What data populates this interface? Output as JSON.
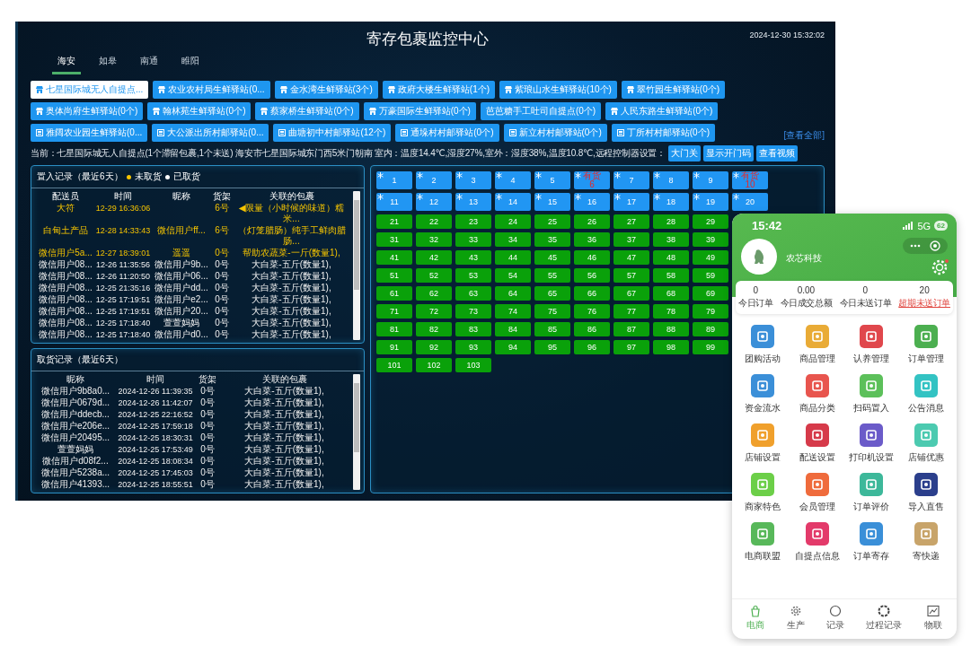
{
  "dashboard": {
    "title": "寄存包裹监控中心",
    "datetime": "2024-12-30 15:32:02",
    "tabs": [
      {
        "label": "海安",
        "selected": true
      },
      {
        "label": "如皋",
        "selected": false
      },
      {
        "label": "南通",
        "selected": false
      },
      {
        "label": "睢阳",
        "selected": false
      }
    ],
    "stations": [
      {
        "label": "七星国际城无人自提点...",
        "kind": "fresh",
        "selected": true
      },
      {
        "label": "农业农村局生鲜驿站(0...",
        "kind": "fresh",
        "selected": false
      },
      {
        "label": "金水湾生鲜驿站(3个)",
        "kind": "fresh",
        "selected": false
      },
      {
        "label": "政府大楼生鲜驿站(1个)",
        "kind": "fresh",
        "selected": false
      },
      {
        "label": "紫琅山水生鲜驿站(10个)",
        "kind": "fresh",
        "selected": false
      },
      {
        "label": "翠竹园生鲜驿站(0个)",
        "kind": "fresh",
        "selected": false
      },
      {
        "label": "奥体尚府生鲜驿站(0个)",
        "kind": "fresh",
        "selected": false
      },
      {
        "label": "翰林苑生鲜驿站(0个)",
        "kind": "fresh",
        "selected": false
      },
      {
        "label": "蔡家桥生鲜驿站(0个)",
        "kind": "fresh",
        "selected": false
      },
      {
        "label": "万豪国际生鲜驿站(0个)",
        "kind": "fresh",
        "selected": false
      },
      {
        "label": "芭芭糖手工吐司自提点(0个)",
        "kind": "pickup",
        "selected": false
      },
      {
        "label": "人民东路生鲜驿站(0个)",
        "kind": "fresh",
        "selected": false
      },
      {
        "label": "雅阔农业园生鲜驿站(0...",
        "kind": "village",
        "selected": false
      },
      {
        "label": "大公派出所村邮驿站(0...",
        "kind": "village",
        "selected": false
      },
      {
        "label": "曲塘初中村邮驿站(12个)",
        "kind": "village",
        "selected": false
      },
      {
        "label": "通垛村村邮驿站(0个)",
        "kind": "village",
        "selected": false
      },
      {
        "label": "新立村村邮驿站(0个)",
        "kind": "village",
        "selected": false
      },
      {
        "label": "丁所村村邮驿站(0个)",
        "kind": "village",
        "selected": false
      }
    ],
    "view_all_link": "[查看全部]",
    "info": {
      "text": "当前：七星国际城无人自提点(1个滞留包裹,1个未送) 海安市七星国际城东门西5米门朝南 室内：温度14.4℃,湿度27%,室外：湿度38%,温度10.8℃,远程控制器设置：",
      "buttons": [
        "大门关",
        "显示开门码",
        "查看视频"
      ]
    },
    "inbound": {
      "title": "置入记录（最近6天）",
      "legend": [
        {
          "label": "未取货",
          "color": "#f5c400"
        },
        {
          "label": "已取货",
          "color": "#ffffff"
        }
      ],
      "columns": [
        "配送员",
        "时间",
        "昵称",
        "货架",
        "关联的包裹"
      ],
      "rows": [
        {
          "cells": [
            "大符",
            "12-29 16:36:06",
            "",
            "6号",
            "◀限量（小时候的味道）糯米..."
          ],
          "picked": false
        },
        {
          "cells": [
            "白甸土产品",
            "12-28 14:33:43",
            "微信用户ff...",
            "6号",
            "（灯笼腊肠）纯手工鲜肉腊肠..."
          ],
          "picked": false
        },
        {
          "cells": [
            "微信用户5a...",
            "12-27 18:39:01",
            "遥遥",
            "0号",
            "帮助农蔬菜-一斤(数量1),"
          ],
          "picked": false
        },
        {
          "cells": [
            "微信用户08...",
            "12-26 11:35:56",
            "微信用户9b...",
            "0号",
            "大白菜-五斤(数量1),"
          ],
          "picked": true
        },
        {
          "cells": [
            "微信用户08...",
            "12-26 11:20:50",
            "微信用户06...",
            "0号",
            "大白菜-五斤(数量1),"
          ],
          "picked": true
        },
        {
          "cells": [
            "微信用户08...",
            "12-25 21:35:16",
            "微信用户dd...",
            "0号",
            "大白菜-五斤(数量1),"
          ],
          "picked": true
        },
        {
          "cells": [
            "微信用户08...",
            "12-25 17:19:51",
            "微信用户e2...",
            "0号",
            "大白菜-五斤(数量1),"
          ],
          "picked": true
        },
        {
          "cells": [
            "微信用户08...",
            "12-25 17:19:51",
            "微信用户20...",
            "0号",
            "大白菜-五斤(数量1),"
          ],
          "picked": true
        },
        {
          "cells": [
            "微信用户08...",
            "12-25 17:18:40",
            "萱萱妈妈",
            "0号",
            "大白菜-五斤(数量1),"
          ],
          "picked": true
        },
        {
          "cells": [
            "微信用户08...",
            "12-25 17:18:40",
            "微信用户d0...",
            "0号",
            "大白菜-五斤(数量1),"
          ],
          "picked": true
        }
      ]
    },
    "outbound": {
      "title": "取货记录（最近6天）",
      "columns": [
        "昵称",
        "时间",
        "货架",
        "关联的包裹"
      ],
      "rows": [
        [
          "微信用户9b8a0...",
          "2024-12-26 11:39:35",
          "0号",
          "大白菜-五斤(数量1),"
        ],
        [
          "微信用户0679d...",
          "2024-12-26 11:42:07",
          "0号",
          "大白菜-五斤(数量1),"
        ],
        [
          "微信用户ddecb...",
          "2024-12-25 22:16:52",
          "0号",
          "大白菜-五斤(数量1),"
        ],
        [
          "微信用户e206e...",
          "2024-12-25 17:59:18",
          "0号",
          "大白菜-五斤(数量1),"
        ],
        [
          "微信用户20495...",
          "2024-12-25 18:30:31",
          "0号",
          "大白菜-五斤(数量1),"
        ],
        [
          "萱萱妈妈",
          "2024-12-25 17:53:49",
          "0号",
          "大白菜-五斤(数量1),"
        ],
        [
          "微信用户d08f2...",
          "2024-12-25 18:08:34",
          "0号",
          "大白菜-五斤(数量1),"
        ],
        [
          "微信用户5238a...",
          "2024-12-25 17:45:03",
          "0号",
          "大白菜-五斤(数量1),"
        ],
        [
          "微信用户41393...",
          "2024-12-25 18:55:51",
          "0号",
          "大白菜-五斤(数量1),"
        ]
      ]
    },
    "locker_rows": [
      [
        {
          "number": "1",
          "kind": "cold"
        },
        {
          "number": "2",
          "kind": "cold"
        },
        {
          "number": "3",
          "kind": "cold"
        },
        {
          "number": "4",
          "kind": "cold"
        },
        {
          "number": "5",
          "kind": "cold"
        },
        {
          "number": "6",
          "kind": "cold",
          "status": "有货"
        },
        {
          "number": "7",
          "kind": "cold"
        },
        {
          "number": "8",
          "kind": "cold"
        },
        {
          "number": "9",
          "kind": "cold"
        },
        {
          "number": "10",
          "kind": "cold",
          "status": "有货"
        }
      ],
      [
        {
          "number": "11",
          "kind": "cold"
        },
        {
          "number": "12",
          "kind": "cold"
        },
        {
          "number": "13",
          "kind": "cold"
        },
        {
          "number": "14",
          "kind": "cold"
        },
        {
          "number": "15",
          "kind": "cold"
        },
        {
          "number": "16",
          "kind": "cold"
        },
        {
          "number": "17",
          "kind": "cold"
        },
        {
          "number": "18",
          "kind": "cold"
        },
        {
          "number": "19",
          "kind": "cold"
        },
        {
          "number": "20",
          "kind": "cold"
        }
      ],
      [
        {
          "number": "21",
          "kind": "normal"
        },
        {
          "number": "22",
          "kind": "normal"
        },
        {
          "number": "23",
          "kind": "normal"
        },
        {
          "number": "24",
          "kind": "normal"
        },
        {
          "number": "25",
          "kind": "normal"
        },
        {
          "number": "26",
          "kind": "normal"
        },
        {
          "number": "27",
          "kind": "normal"
        },
        {
          "number": "28",
          "kind": "normal"
        },
        {
          "number": "29",
          "kind": "normal"
        }
      ],
      [
        {
          "number": "31",
          "kind": "normal"
        },
        {
          "number": "32",
          "kind": "normal"
        },
        {
          "number": "33",
          "kind": "normal"
        },
        {
          "number": "34",
          "kind": "normal"
        },
        {
          "number": "35",
          "kind": "normal"
        },
        {
          "number": "36",
          "kind": "normal"
        },
        {
          "number": "37",
          "kind": "normal"
        },
        {
          "number": "38",
          "kind": "normal"
        },
        {
          "number": "39",
          "kind": "normal"
        }
      ],
      [
        {
          "number": "41",
          "kind": "normal"
        },
        {
          "number": "42",
          "kind": "normal"
        },
        {
          "number": "43",
          "kind": "normal"
        },
        {
          "number": "44",
          "kind": "normal"
        },
        {
          "number": "45",
          "kind": "normal"
        },
        {
          "number": "46",
          "kind": "normal"
        },
        {
          "number": "47",
          "kind": "normal"
        },
        {
          "number": "48",
          "kind": "normal"
        },
        {
          "number": "49",
          "kind": "normal"
        }
      ],
      [
        {
          "number": "51",
          "kind": "normal"
        },
        {
          "number": "52",
          "kind": "normal"
        },
        {
          "number": "53",
          "kind": "normal"
        },
        {
          "number": "54",
          "kind": "normal"
        },
        {
          "number": "55",
          "kind": "normal"
        },
        {
          "number": "56",
          "kind": "normal"
        },
        {
          "number": "57",
          "kind": "normal"
        },
        {
          "number": "58",
          "kind": "normal"
        },
        {
          "number": "59",
          "kind": "normal"
        }
      ],
      [
        {
          "number": "61",
          "kind": "normal"
        },
        {
          "number": "62",
          "kind": "normal"
        },
        {
          "number": "63",
          "kind": "normal"
        },
        {
          "number": "64",
          "kind": "normal"
        },
        {
          "number": "65",
          "kind": "normal"
        },
        {
          "number": "66",
          "kind": "normal"
        },
        {
          "number": "67",
          "kind": "normal"
        },
        {
          "number": "68",
          "kind": "normal"
        },
        {
          "number": "69",
          "kind": "normal"
        }
      ],
      [
        {
          "number": "71",
          "kind": "normal"
        },
        {
          "number": "72",
          "kind": "normal"
        },
        {
          "number": "73",
          "kind": "normal"
        },
        {
          "number": "74",
          "kind": "normal"
        },
        {
          "number": "75",
          "kind": "normal"
        },
        {
          "number": "76",
          "kind": "normal"
        },
        {
          "number": "77",
          "kind": "normal"
        },
        {
          "number": "78",
          "kind": "normal"
        },
        {
          "number": "79",
          "kind": "normal"
        }
      ],
      [
        {
          "number": "81",
          "kind": "normal"
        },
        {
          "number": "82",
          "kind": "normal"
        },
        {
          "number": "83",
          "kind": "normal"
        },
        {
          "number": "84",
          "kind": "normal"
        },
        {
          "number": "85",
          "kind": "normal"
        },
        {
          "number": "86",
          "kind": "normal"
        },
        {
          "number": "87",
          "kind": "normal"
        },
        {
          "number": "88",
          "kind": "normal"
        },
        {
          "number": "89",
          "kind": "normal"
        }
      ],
      [
        {
          "number": "91",
          "kind": "normal"
        },
        {
          "number": "92",
          "kind": "normal"
        },
        {
          "number": "93",
          "kind": "normal"
        },
        {
          "number": "94",
          "kind": "normal"
        },
        {
          "number": "95",
          "kind": "normal"
        },
        {
          "number": "96",
          "kind": "normal"
        },
        {
          "number": "97",
          "kind": "normal"
        },
        {
          "number": "98",
          "kind": "normal"
        },
        {
          "number": "99",
          "kind": "normal"
        }
      ],
      [
        {
          "number": "101",
          "kind": "normal"
        },
        {
          "number": "102",
          "kind": "normal"
        },
        {
          "number": "103",
          "kind": "normal"
        }
      ]
    ]
  },
  "phone": {
    "status_bar": {
      "time": "15:42",
      "network": "5G",
      "battery": "62"
    },
    "shop_name": "农芯科技",
    "stats": [
      {
        "value": "0",
        "label": "今日订单",
        "kind": "normal"
      },
      {
        "value": "0.00",
        "label": "今日成交总额",
        "kind": "normal"
      },
      {
        "value": "0",
        "label": "今日未送订单",
        "kind": "normal"
      },
      {
        "value": "20",
        "label": "超期未送订单",
        "kind": "alert"
      }
    ],
    "items": [
      {
        "label": "团购活动",
        "color": "#3b8fd8"
      },
      {
        "label": "商品管理",
        "color": "#e9ab36"
      },
      {
        "label": "认养管理",
        "color": "#e0474c"
      },
      {
        "label": "订单管理",
        "color": "#4caf50"
      },
      {
        "label": "资金流水",
        "color": "#3b8fd8"
      },
      {
        "label": "商品分类",
        "color": "#e8554e"
      },
      {
        "label": "扫码置入",
        "color": "#5cc05a"
      },
      {
        "label": "公告消息",
        "color": "#33c3c3"
      },
      {
        "label": "店铺设置",
        "color": "#f0a02c"
      },
      {
        "label": "配送设置",
        "color": "#d63a4a"
      },
      {
        "label": "打印机设置",
        "color": "#6b5bc9"
      },
      {
        "label": "店铺优惠",
        "color": "#4ccab0"
      },
      {
        "label": "商家特色",
        "color": "#6ccf48"
      },
      {
        "label": "会员管理",
        "color": "#ef6b3c"
      },
      {
        "label": "订单评价",
        "color": "#3db89a"
      },
      {
        "label": "导入直售",
        "color": "#2b3f8c"
      },
      {
        "label": "电商联盟",
        "color": "#58b85a"
      },
      {
        "label": "自提点信息",
        "color": "#e33a6a"
      },
      {
        "label": "订单寄存",
        "color": "#3a8fd8"
      },
      {
        "label": "寄快递",
        "color": "#c8a46a"
      }
    ],
    "nav": [
      {
        "label": "电商",
        "selected": true
      },
      {
        "label": "生产",
        "selected": false
      },
      {
        "label": "记录",
        "selected": false
      },
      {
        "label": "过程记录",
        "selected": false
      },
      {
        "label": "物联",
        "selected": false
      }
    ]
  }
}
